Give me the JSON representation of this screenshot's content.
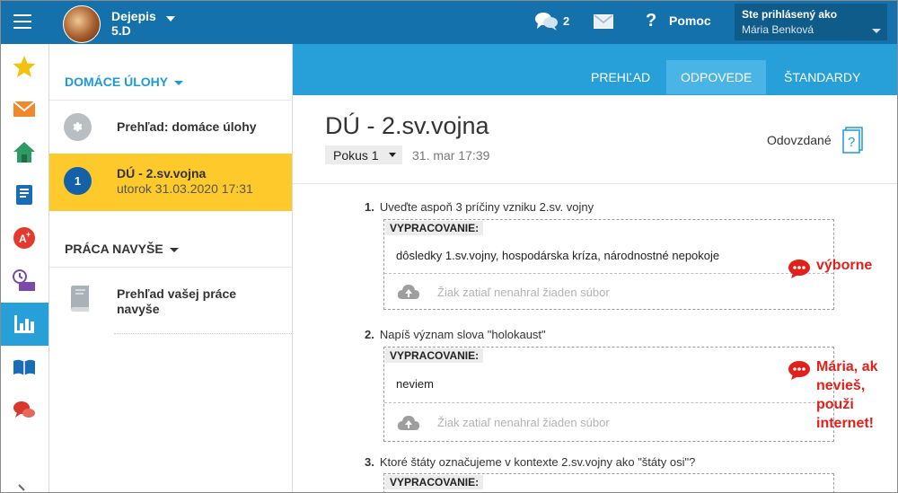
{
  "header": {
    "course_title": "Dejepis",
    "course_class": "5.D",
    "message_count": "2",
    "help_label": "Pomoc",
    "logged_in_label": "Ste prihlásený ako",
    "user_name": "Mária Benková"
  },
  "rail": {
    "items": [
      "star-icon",
      "mail-icon",
      "home-icon",
      "notebook-icon",
      "grade-icon",
      "desk-icon",
      "stats-icon",
      "open-book-icon",
      "discussion-icon"
    ],
    "active": "stats-icon"
  },
  "sidebar": {
    "section1": "DOMÁCE ÚLOHY",
    "overview": "Prehľad: domáce úlohy",
    "task_number": "1",
    "task_title": "DÚ - 2.sv.vojna",
    "task_date": "utorok 31.03.2020 17:31",
    "section2": "PRÁCA NAVYŠE",
    "extra_overview": "Prehľad vašej práce navyše"
  },
  "tabs": [
    "PREHĽAD",
    "ODPOVEDE",
    "ŠTANDARDY"
  ],
  "active_tab": "ODPOVEDE",
  "main": {
    "title": "DÚ - 2.sv.vojna",
    "attempt": "Pokus 1",
    "date": "31. mar 17:39",
    "status": "Odovzdané",
    "questions": [
      {
        "num": "1.",
        "text": "Uveďte aspoň 3 príčiny vzniku 2.sv. vojny",
        "label": "VYPRACOVANIE:",
        "answer": "dôsledky 1.sv.vojny, hospodárska kríza, národnostné nepokoje",
        "upload": "Žiak zatiaľ nenahral žiaden súbor",
        "comment": "výborne"
      },
      {
        "num": "2.",
        "text": "Napíš význam slova \"holokaust\"",
        "label": "VYPRACOVANIE:",
        "answer": "neviem",
        "upload": "Žiak zatiaľ nenahral žiaden súbor",
        "comment": "Mária, ak nevieš, použi internet!"
      },
      {
        "num": "3.",
        "text": "Ktoré štáty označujeme v kontexte 2.sv.vojny ako \"štáty osi\"?",
        "label": "VYPRACOVANIE:"
      }
    ]
  },
  "colors": {
    "topbar": "#1471ab",
    "accent": "#27a0da",
    "highlight": "#fec92b",
    "comment": "#e2201a"
  }
}
